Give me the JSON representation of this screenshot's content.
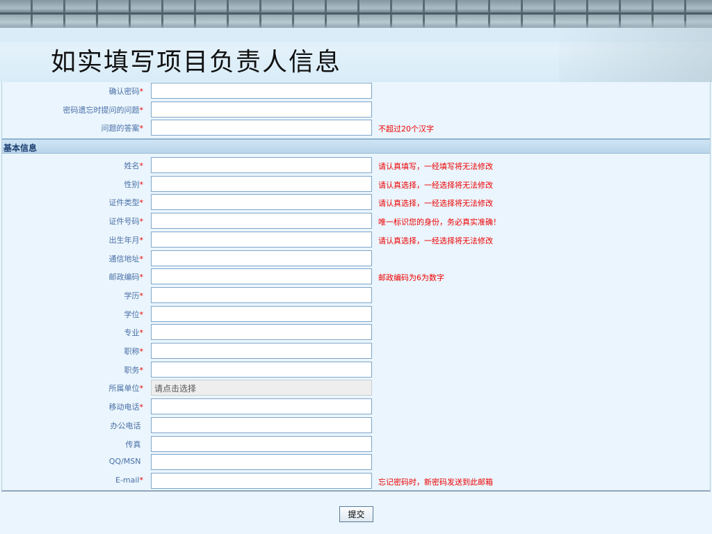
{
  "header": {
    "title": "如实填写项目负责人信息"
  },
  "account_rows": [
    {
      "label": "确认密码",
      "required": true,
      "hint": ""
    },
    {
      "label": "密码遗忘时提问的问题",
      "required": true,
      "hint": ""
    },
    {
      "label": "问题的答案",
      "required": true,
      "hint": "不超过20个汉字"
    }
  ],
  "section_title": "基本信息",
  "basic_rows": [
    {
      "label": "姓名",
      "required": true,
      "hint": "请认真填写，一经填写将无法修改"
    },
    {
      "label": "性别",
      "required": true,
      "hint": "请认真选择，一经选择将无法修改"
    },
    {
      "label": "证件类型",
      "required": true,
      "hint": "请认真选择，一经选择将无法修改"
    },
    {
      "label": "证件号码",
      "required": true,
      "hint": "唯一标识您的身份，务必真实准确！"
    },
    {
      "label": "出生年月",
      "required": true,
      "hint": "请认真选择，一经选择将无法修改"
    },
    {
      "label": "通信地址",
      "required": true,
      "hint": ""
    },
    {
      "label": "邮政编码",
      "required": true,
      "hint": "邮政编码为6为数字"
    },
    {
      "label": "学历",
      "required": true,
      "hint": ""
    },
    {
      "label": "学位",
      "required": true,
      "hint": ""
    },
    {
      "label": "专业",
      "required": true,
      "hint": ""
    },
    {
      "label": "职称",
      "required": true,
      "hint": ""
    },
    {
      "label": "职务",
      "required": true,
      "hint": ""
    },
    {
      "label": "所属单位",
      "required": true,
      "hint": "",
      "value": "请点击选择",
      "readonly": true
    },
    {
      "label": "移动电话",
      "required": true,
      "hint": ""
    },
    {
      "label": "办公电话",
      "required": false,
      "hint": ""
    },
    {
      "label": "传真",
      "required": false,
      "hint": ""
    },
    {
      "label": "QQ/MSN",
      "required": false,
      "hint": ""
    },
    {
      "label": "E-mail",
      "required": true,
      "hint": "忘记密码时，新密码发送到此邮箱"
    }
  ],
  "submit_label": "提交"
}
